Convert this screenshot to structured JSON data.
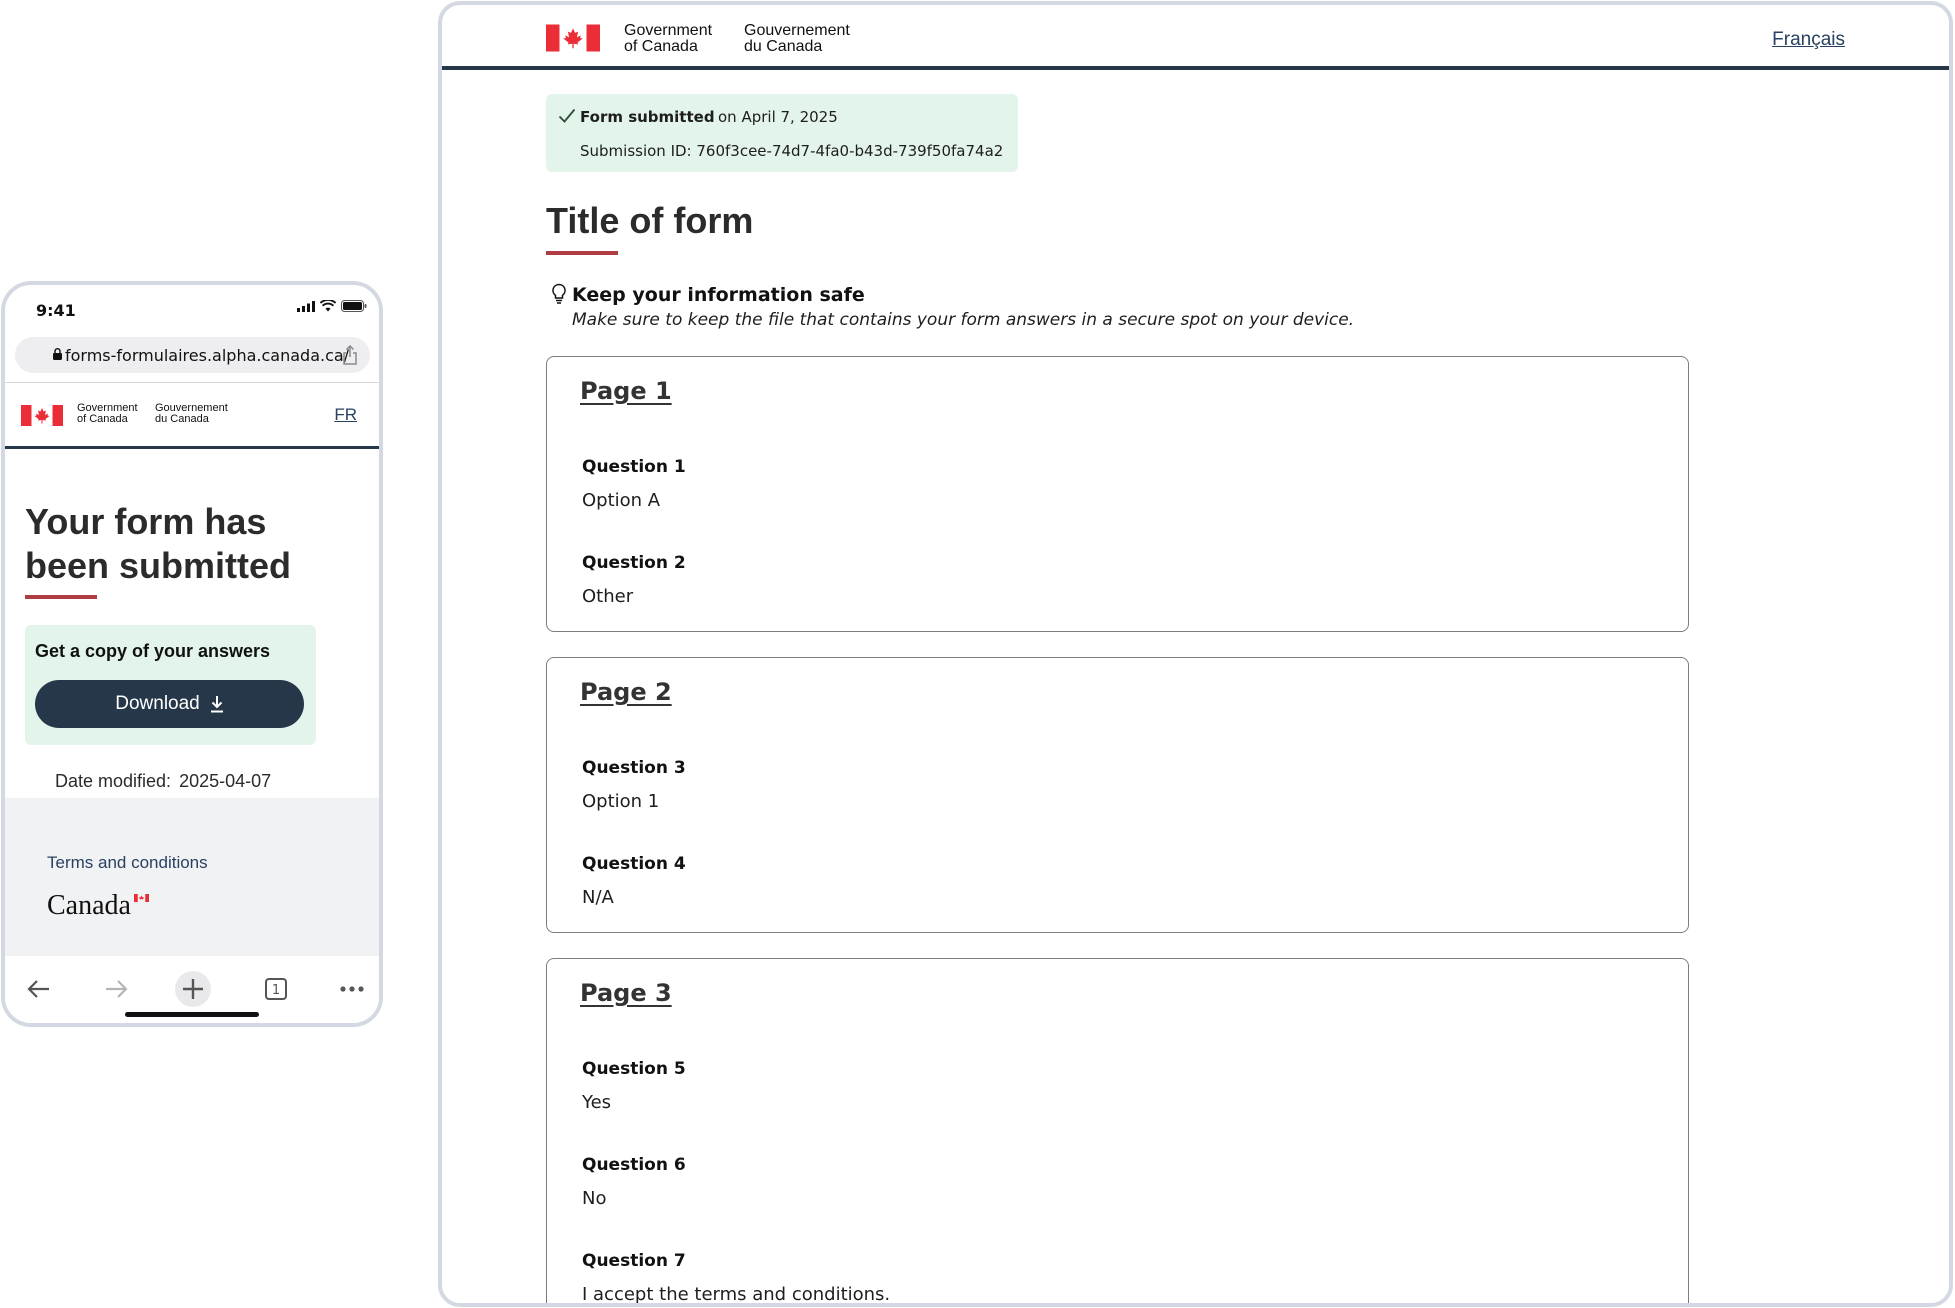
{
  "mobile": {
    "status_time": "9:41",
    "url": "forms-formulaires.alpha.canada.ca/",
    "signature_en_line1": "Government",
    "signature_en_line2": "of Canada",
    "signature_fr_line1": "Gouvernement",
    "signature_fr_line2": "du Canada",
    "language_toggle": "FR",
    "page_title": "Your form has been submitted",
    "copy_card_title": "Get a copy of your answers",
    "download_label": "Download",
    "date_modified_label": "Date modified:",
    "date_modified_value": "2025-04-07",
    "terms_link": "Terms and conditions",
    "wordmark": "Canada",
    "tab_count": "1"
  },
  "desktop": {
    "signature_en_line1": "Government",
    "signature_en_line2": "of Canada",
    "signature_fr_line1": "Gouvernement",
    "signature_fr_line2": "du Canada",
    "language_toggle": "Français",
    "banner": {
      "status": "Form submitted",
      "date": "on April 7, 2025",
      "submission_id": "Submission ID: 760f3cee-74d7-4fa0-b43d-739f50fa74a2"
    },
    "form_title": "Title of form",
    "tip": {
      "title": "Keep your information safe",
      "text": "Make sure to keep the file that contains your form answers in a secure spot on your device."
    },
    "pages": [
      {
        "heading": "Page 1",
        "questions": [
          {
            "label": "Question 1",
            "answer": "Option A"
          },
          {
            "label": "Question 2",
            "answer": "Other"
          }
        ]
      },
      {
        "heading": "Page 2",
        "questions": [
          {
            "label": "Question 3",
            "answer": "Option 1"
          },
          {
            "label": "Question 4",
            "answer": "N/A"
          }
        ]
      },
      {
        "heading": "Page 3",
        "questions": [
          {
            "label": "Question 5",
            "answer": "Yes"
          },
          {
            "label": "Question 6",
            "answer": "No"
          },
          {
            "label": "Question 7",
            "answer": "I accept the terms and conditions."
          }
        ]
      }
    ]
  },
  "colors": {
    "navy": "#26374a",
    "accent_red": "#af3c43",
    "flag_red": "#eb2d37",
    "success_bg": "#e3f4ea",
    "link": "#284162"
  },
  "icons": {
    "status": [
      "signal-icon",
      "wifi-icon",
      "battery-icon"
    ],
    "browser": [
      "lock-icon",
      "share-icon",
      "back-icon",
      "forward-icon",
      "new-tab-icon",
      "tabs-icon",
      "more-icon"
    ],
    "content": [
      "checkmark-icon",
      "lightbulb-icon",
      "download-icon",
      "canada-flag-icon"
    ]
  }
}
